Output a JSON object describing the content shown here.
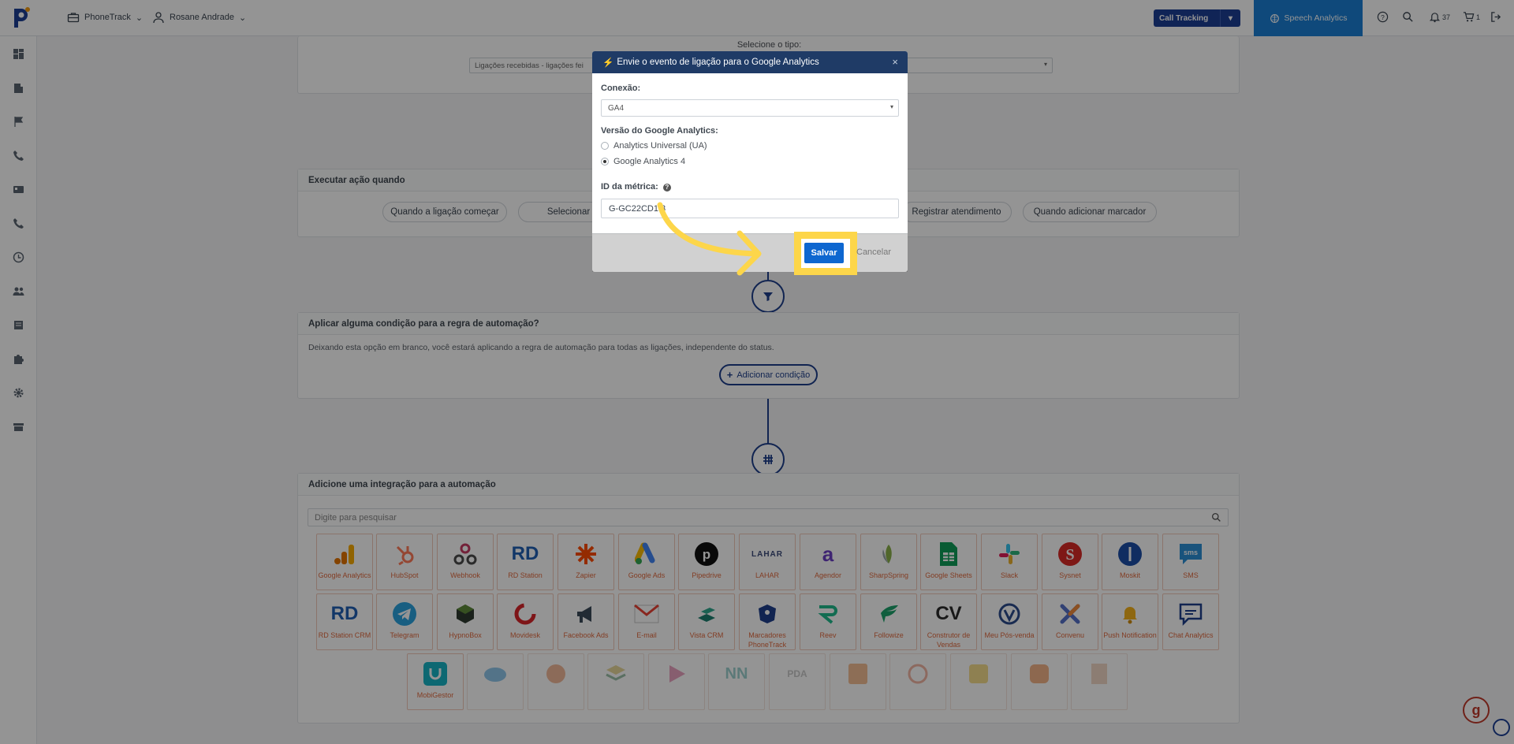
{
  "topbar": {
    "account_menu": "PhoneTrack",
    "user_menu": "Rosane Andrade",
    "call_tracking_label": "Call Tracking",
    "speech_analytics_label": "Speech Analytics",
    "notifications_count": "37",
    "cart_count": "1"
  },
  "sidebar": {
    "icons": [
      "dashboard-icon",
      "building-icon",
      "flag-icon",
      "phone-icon",
      "id-card-icon",
      "phone-alt-icon",
      "clock-icon",
      "users-icon",
      "book-icon",
      "puzzle-icon",
      "gear-icon",
      "store-icon"
    ]
  },
  "page": {
    "type_label": "Selecione o tipo:",
    "type_value": "Ligações recebidas - ligações fei",
    "trigger_title": "Executar ação quando",
    "triggers": [
      "Quando a ligação começar",
      "Selecionar Menu",
      "Registrar atendimento",
      "Quando adicionar marcador"
    ],
    "condition_title": "Aplicar alguma condição para a regra de automação?",
    "condition_desc": "Deixando esta opção em branco, você estará aplicando a regra de automação para todas as ligações, independente do status.",
    "add_condition": "Adicionar condição",
    "integration_title": "Adicione uma integração para a automação",
    "search_placeholder": "Digite para pesquisar",
    "integrations_row1": [
      "Google Analytics",
      "HubSpot",
      "Webhook",
      "RD Station",
      "Zapier",
      "Google Ads",
      "Pipedrive",
      "LAHAR",
      "Agendor",
      "SharpSpring",
      "Google Sheets",
      "Slack",
      "Sysnet",
      "Moskit",
      "SMS"
    ],
    "integrations_row2": [
      "RD Station CRM",
      "Telegram",
      "HypnoBox",
      "Movidesk",
      "Facebook Ads",
      "E-mail",
      "Vista CRM",
      "Marcadores PhoneTrack",
      "Reev",
      "Followize",
      "Construtor de Vendas",
      "Meu Pós-venda",
      "Convenu",
      "Push Notification",
      "Chat Analytics"
    ],
    "integrations_row3": [
      "MobiGestor",
      "",
      "",
      "",
      "",
      "",
      "",
      "",
      "",
      "",
      "",
      ""
    ]
  },
  "modal": {
    "title": "Envie o evento de ligação para o Google Analytics",
    "connection_label": "Conexão:",
    "connection_value": "GA4",
    "version_label": "Versão do Google Analytics:",
    "option_ua": "Analytics Universal (UA)",
    "option_ga4": "Google Analytics 4",
    "metric_label": "ID da métrica:",
    "metric_value": "G-GC22CD1  3",
    "save_label": "Salvar",
    "cancel_label": "Cancelar"
  },
  "colors": {
    "primary": "#1c3f94",
    "accent": "#1a7fd4",
    "highlight": "#fdd64a",
    "save": "#0e67d0",
    "modal_header": "#1f3b66"
  }
}
